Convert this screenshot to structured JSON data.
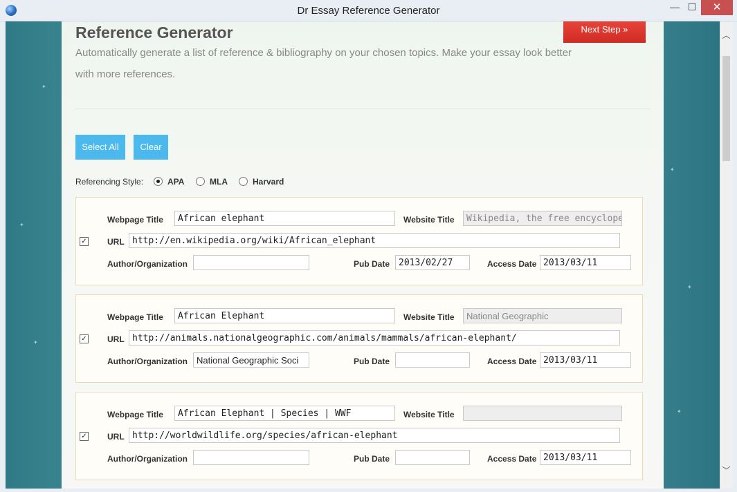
{
  "window": {
    "title": "Dr Essay Reference Generator",
    "controls": {
      "minimize": "—",
      "maximize": "☐",
      "close": "✕"
    }
  },
  "header": {
    "title": "Reference Generator",
    "description": "Automatically generate a list of reference & bibliography on your chosen topics. Make your essay look better with more references.",
    "next_button": "Next Step »"
  },
  "actions": {
    "select_all": "Select All",
    "clear": "Clear"
  },
  "referencing_style": {
    "label": "Referencing Style:",
    "options": [
      "APA",
      "MLA",
      "Harvard"
    ],
    "selected": "APA"
  },
  "labels": {
    "webpage_title": "Webpage Title",
    "website_title": "Website Title",
    "url": "URL",
    "author": "Author/Organization",
    "pub_date": "Pub Date",
    "access_date": "Access Date"
  },
  "references": [
    {
      "checked": "✓",
      "webpage_title": "African elephant",
      "website_title": "Wikipedia, the free encyclopedia",
      "url": "http://en.wikipedia.org/wiki/African_elephant",
      "author": "",
      "pub_date": "2013/02/27",
      "access_date": "2013/03/11"
    },
    {
      "checked": "✓",
      "webpage_title": "African Elephant",
      "website_title": "National Geographic",
      "url": "http://animals.nationalgeographic.com/animals/mammals/african-elephant/",
      "author": "National Geographic Soci",
      "pub_date": "",
      "access_date": "2013/03/11"
    },
    {
      "checked": "✓",
      "webpage_title": "African Elephant | Species | WWF",
      "website_title": "",
      "url": "http://worldwildlife.org/species/african-elephant",
      "author": "",
      "pub_date": "",
      "access_date": "2013/03/11"
    }
  ],
  "colors": {
    "next_button": "#d9322a",
    "action_buttons": "#4bb8ee",
    "card_border": "#f0d9b5"
  }
}
